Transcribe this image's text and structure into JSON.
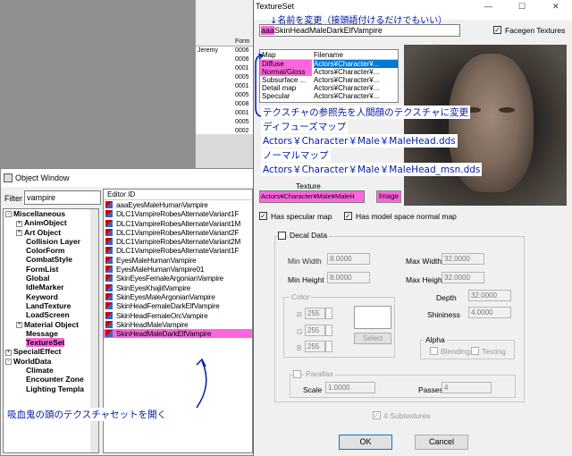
{
  "background_window": {
    "column_header": "Form",
    "rows": [
      {
        "name": "Jeremy",
        "form": "0006"
      },
      {
        "name": "",
        "form": "0006"
      },
      {
        "name": "",
        "form": "0001"
      },
      {
        "name": "",
        "form": "0005"
      },
      {
        "name": "",
        "form": "0001"
      },
      {
        "name": "",
        "form": "0005"
      },
      {
        "name": "",
        "form": "0008"
      },
      {
        "name": "",
        "form": "0001"
      },
      {
        "name": "",
        "form": "0005"
      },
      {
        "name": "",
        "form": "0002"
      }
    ]
  },
  "object_window": {
    "title": "Object Window",
    "filter_label": "Filter",
    "filter_value": "vampire",
    "tree_items": [
      {
        "label": "Miscellaneous",
        "expander": "-",
        "indent": 0
      },
      {
        "label": "AnimObject",
        "expander": "+",
        "indent": 1
      },
      {
        "label": "Art Object",
        "expander": "+",
        "indent": 1
      },
      {
        "label": "Collision Layer",
        "expander": "",
        "indent": 1
      },
      {
        "label": "ColorForm",
        "expander": "",
        "indent": 1
      },
      {
        "label": "CombatStyle",
        "expander": "",
        "indent": 1
      },
      {
        "label": "FormList",
        "expander": "",
        "indent": 1
      },
      {
        "label": "Global",
        "expander": "",
        "indent": 1
      },
      {
        "label": "IdleMarker",
        "expander": "",
        "indent": 1
      },
      {
        "label": "Keyword",
        "expander": "",
        "indent": 1
      },
      {
        "label": "LandTexture",
        "expander": "",
        "indent": 1
      },
      {
        "label": "LoadScreen",
        "expander": "",
        "indent": 1
      },
      {
        "label": "Material Object",
        "expander": "+",
        "indent": 1
      },
      {
        "label": "Message",
        "expander": "",
        "indent": 1
      },
      {
        "label": "TextureSet",
        "expander": "",
        "indent": 1,
        "selected": true
      },
      {
        "label": "SpecialEffect",
        "expander": "+",
        "indent": 0
      },
      {
        "label": "WorldData",
        "expander": "-",
        "indent": 0
      },
      {
        "label": "Climate",
        "expander": "",
        "indent": 1
      },
      {
        "label": "Encounter Zone",
        "expander": "",
        "indent": 1
      },
      {
        "label": "Lighting Templa",
        "expander": "",
        "indent": 1
      }
    ],
    "list_header": "Editor ID",
    "list_items": [
      "aaaEyesMaleHumanVampire",
      "DLC1VampireRobesAlternateVariant1F",
      "DLC1VampireRobesAlternateVariant1M",
      "DLC1VampireRobesAlternateVariant2F",
      "DLC1VampireRobesAlternateVariant2M",
      "DLC1VampireRobesAlternateVariant1F",
      "EyesMaleHumanVampire",
      "EyesMaleHumanVampire01",
      "SkinEyesFemaleArgonianVampire",
      "SkinEyesKhajiitVampire",
      "SkinEyesMaleArgonianVampire",
      "SkinHeadFemaleDarkElfVampire",
      "SkinHeadFemaleOrcVampire",
      "SkinHeadMaleVampire",
      "SkinHeadMaleDarkElfVampire"
    ],
    "selected_index": 14
  },
  "texture_set": {
    "title": "TextureSet",
    "editor_id_prefix": "aaa",
    "editor_id_rest": "SkinHeadMaleDarkElfVampire",
    "facegen_label": "Facegen Textures",
    "map_header": "Map",
    "filename_header": "Filename",
    "maps": [
      {
        "map": "Diffuse",
        "file": "Actors¥Character¥..."
      },
      {
        "map": "Normal/Gloss",
        "file": "Actors¥Character¥..."
      },
      {
        "map": "Subsurface ...",
        "file": "Actors¥Character¥..."
      },
      {
        "map": "Detail map",
        "file": "Actors¥Character¥..."
      },
      {
        "map": "Specular",
        "file": "Actors¥Character¥..."
      }
    ],
    "texture_label": "Texture",
    "texture_path": "Actors¥Character¥Male¥MaleH",
    "image_button": "Image",
    "has_specular": "Has specular map",
    "has_model_space": "Has model space normal map",
    "decal_data": "Decal Data",
    "min_width_label": "Min Width",
    "min_width": "8.0000",
    "max_width_label": "Max Width",
    "max_width": "32.0000",
    "min_height_label": "Min Height",
    "min_height": "8.0000",
    "max_height_label": "Max Height",
    "max_height": "32.0000",
    "color_label": "Color",
    "r_label": "R",
    "g_label": "G",
    "b_label": "B",
    "r": "255",
    "g": "255",
    "b": "255",
    "select_button": "Select",
    "depth_label": "Depth",
    "depth": "32.0000",
    "shininess_label": "Shininess",
    "shininess": "4.0000",
    "alpha_label": "Alpha",
    "blending": "Blending",
    "testing": "Testing",
    "parallax": "Parallax",
    "scale_label": "Scale",
    "scale": "1.0000",
    "passes_label": "Passes",
    "passes": "4",
    "subtextures": "4 Subtextures",
    "ok": "OK",
    "cancel": "Cancel"
  },
  "annotations": {
    "rename": "↓名前を変更（接頭語付けるだけでもいい）",
    "reference": "テクスチャの参照先を人間顔のテクスチャに変更",
    "diffuse_map": "ディフューズマップ",
    "diffuse_path": "Actors￥Character￥Male￥MaleHead.dds",
    "normal_map": "ノーマルマップ",
    "normal_path": "Actors￥Character￥Male￥MaleHead_msn.dds",
    "open_texset": "吸血鬼の頭のテクスチャセットを開く"
  },
  "colors": {
    "highlight": "#ff66dd",
    "annotation": "#0019a8"
  }
}
